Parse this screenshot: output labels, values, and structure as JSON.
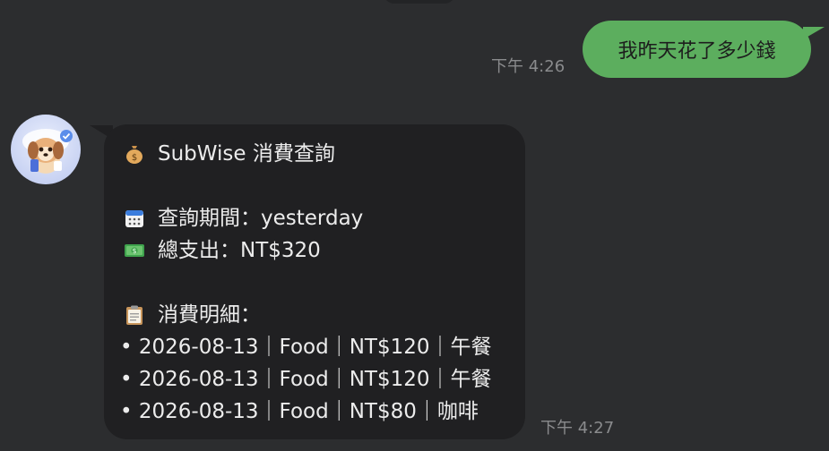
{
  "outgoing": {
    "time": "下午 4:26",
    "text": "我昨天花了多少錢"
  },
  "incoming": {
    "time": "下午 4:27",
    "title": "SubWise 消費查詢",
    "period_line": "查詢期間：yesterday",
    "total_line": "總支出：NT$320",
    "detail_header": "消費明細：",
    "items": [
      "• 2026-08-13｜Food｜NT$120｜午餐",
      "• 2026-08-13｜Food｜NT$120｜午餐",
      "• 2026-08-13｜Food｜NT$80｜咖啡"
    ],
    "icons": {
      "title": "money-bag-icon",
      "period": "calendar-icon",
      "total": "money-bill-icon",
      "detail": "clipboard-icon"
    }
  },
  "colors": {
    "background": "#2c2d2f",
    "outgoing_bubble": "#5cae5e",
    "incoming_bubble": "#202022",
    "timestamp": "#8a8b8d"
  }
}
